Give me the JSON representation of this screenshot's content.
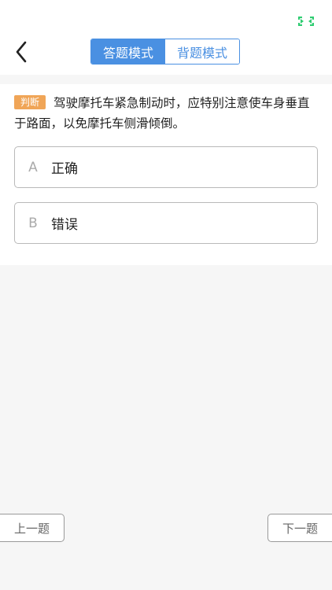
{
  "header": {
    "mode_tabs": [
      {
        "label": "答题模式",
        "active": true
      },
      {
        "label": "背题模式",
        "active": false
      }
    ]
  },
  "question": {
    "type_badge": "判断",
    "text": "驾驶摩托车紧急制动时，应特别注意使车身垂直于路面，以免摩托车侧滑倾倒。",
    "options": [
      {
        "letter": "A",
        "label": "正确"
      },
      {
        "letter": "B",
        "label": "错误"
      }
    ]
  },
  "navigation": {
    "prev_label": "上一题",
    "next_label": "下一题"
  },
  "colors": {
    "accent": "#4a90e2",
    "badge": "#f0a557",
    "status_icon": "#2ecc71"
  },
  "icons": {
    "back": "chevron-left-icon",
    "status": "fullscreen-icon"
  }
}
